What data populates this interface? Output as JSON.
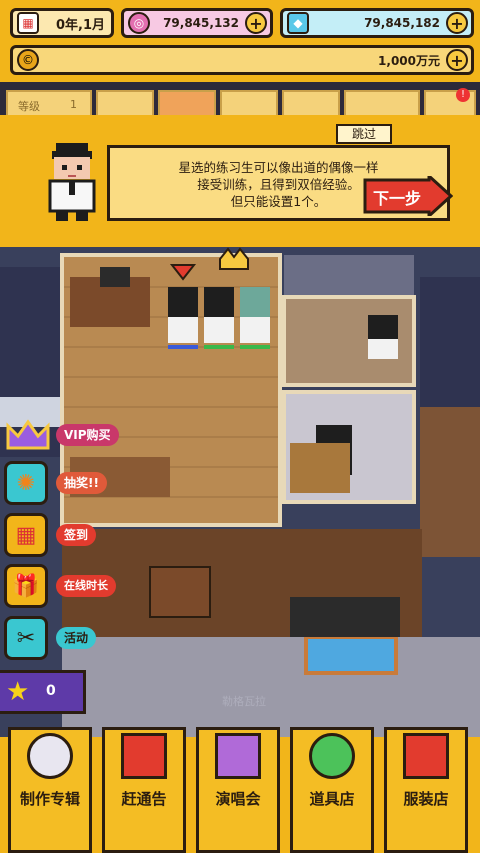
{
  "hud": {
    "date": "0年,1月",
    "coins_pink": "79,845,132",
    "gems": "79,845,182",
    "money": "1,000万元",
    "level_label": "等级",
    "level_value": "1"
  },
  "tutorial": {
    "skip": "跳过",
    "message_line1": "星选的练习生可以像出道的偶像一样",
    "message_line2": "接受训练，且得到双倍经验。",
    "message_line3": "但只能设置1个。",
    "next": "下一步"
  },
  "side": {
    "vip": "VIP购买",
    "lottery": "抽奖!!",
    "checkin": "签到",
    "online": "在线时长",
    "event": "活动",
    "stars": "0"
  },
  "world": {
    "ghost_label": "勒格瓦拉"
  },
  "nav": {
    "items": [
      {
        "label": "制作专辑",
        "icon": "cd-icon"
      },
      {
        "label": "赶通告",
        "icon": "calendar-icon"
      },
      {
        "label": "演唱会",
        "icon": "rainbow-icon"
      },
      {
        "label": "道具店",
        "icon": "clover-icon"
      },
      {
        "label": "服装店",
        "icon": "shirt-icon"
      }
    ]
  },
  "colors": {
    "accent": "#f2b51a",
    "dark": "#2b1d10",
    "next_red": "#e23b2e"
  }
}
